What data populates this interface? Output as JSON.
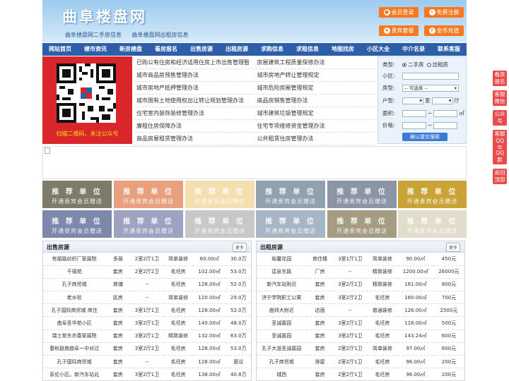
{
  "header": {
    "title": "曲阜楼盘网",
    "subtitle_links": [
      "曲阜楼盘网二手房信息",
      "曲阜楼盘网出租房信息"
    ],
    "buttons": [
      {
        "label": "会员登录",
        "icon": "user-icon"
      },
      {
        "label": "免费注册",
        "icon": "register-icon"
      },
      {
        "label": "贵宾套餐",
        "icon": "vip-icon"
      },
      {
        "label": "金币充值",
        "icon": "coin-icon"
      }
    ],
    "accent": "#f47920"
  },
  "nav": [
    "网站首页",
    "楼市资讯",
    "新房楼盘",
    "看房报名",
    "出售房源",
    "出租房源",
    "求购信息",
    "求租信息",
    "地图找房",
    "小区大全",
    "中介名录",
    "联系客服"
  ],
  "qr": {
    "caption": "扫描二维码，关注公众号"
  },
  "links": [
    [
      "已购公有住房和经济适用住房上市出售管理暂",
      "房屋建筑工程质量保修办法"
    ],
    [
      "城市商品房预售管理办法",
      "城市房地产转让管理规定"
    ],
    [
      "城市房地产抵押管理办法",
      "城市危险房屋管理规定"
    ],
    [
      "城市国有土地使用权出让转让规划管理办法",
      "商品房销售管理办法"
    ],
    [
      "住宅室内装饰装修管理办法",
      "城市建筑垃圾管理规定"
    ],
    [
      "廉租住房保障办法",
      "住宅专项维修资金管理办法"
    ],
    [
      "商品房屋租赁管理办法",
      "公共租赁住房管理办法"
    ]
  ],
  "search": {
    "type_label": "类型:",
    "opt1": "二手房",
    "opt2": "出租房",
    "area_label": "小区:",
    "kind_label": "房型:",
    "kind_value": "-- 可选择 --",
    "layout_label": "户型:",
    "room": "室",
    "hall": "厅",
    "size_label": "面积:",
    "size_unit": "㎡",
    "price_label": "价格:",
    "price_sep": "~",
    "submit": "确认提交搜索"
  },
  "ads": {
    "line1": "推 荐 单 位",
    "line2": "开通贵宾会员赠送",
    "colors": [
      "#7f7b6b",
      "#e8a07f",
      "#f3dfb0",
      "#8fa2ad",
      "#8c95a3",
      "#c9a336",
      "#7d88ad",
      "#9fa3c2",
      "#c8c8c8",
      "#a7b6c5",
      "#a59c82",
      "#e1dccb"
    ]
  },
  "sale": {
    "title": "出售房源",
    "more": "更多",
    "rows": [
      [
        "有朋路纺织厂家属院",
        "多层",
        "2室2厅1卫",
        "简单装修",
        "60.00㎡",
        "30.0万"
      ],
      [
        "千禧苑",
        "套房",
        "2室2厅2卫",
        "毛坯房",
        "102.00㎡",
        "53.0万"
      ],
      [
        "孔子商贸城",
        "商铺",
        "--",
        "毛坯房",
        "128.00㎡",
        "52.0万"
      ],
      [
        "老水校",
        "民房",
        "--",
        "简单装修",
        "120.00㎡",
        "29.0万"
      ],
      [
        "孔子国际商贸城 商住",
        "套房",
        "3室1厅1卫",
        "毛坯房",
        "128.00㎡",
        "52.0万"
      ],
      [
        "曲阜圣华苑小区",
        "套房",
        "3室2厅1卫",
        "毛坯房",
        "140.00㎡",
        "48.0万"
      ],
      [
        "瑞士苑东农委家属院",
        "套房",
        "3室2厅1卫",
        "精致装修",
        "132.00㎡",
        "63.0万"
      ],
      [
        "春秋路南曲阜一中对过",
        "套房",
        "3室2厅2卫",
        "毛坯房",
        "128.00㎡",
        "53.0万"
      ],
      [
        "孔子国际商贸城",
        "套房",
        "--",
        "毛坯房",
        "128.00㎡",
        "面议"
      ],
      [
        "系伦小区。新汽车站北",
        "套房",
        "3室2厅1卫",
        "毛坯房",
        "138.00㎡",
        "40.8万"
      ]
    ]
  },
  "rent": {
    "title": "出租房源",
    "more": "更多",
    "rows": [
      [
        "裕馨花园",
        "商住楼",
        "3室1厅1卫",
        "简单装修",
        "90.00㎡",
        "450元"
      ],
      [
        "逵泉东路",
        "厂房",
        "--",
        "精致装修",
        "1200.00㎡",
        "26000元"
      ],
      [
        "新汽车站附近",
        "套房",
        "3室2厅2卫",
        "精致装修",
        "161.00㎡",
        "800元"
      ],
      [
        "济宁学院职工公寓",
        "套房",
        "3室2厅2卫",
        "毛坯房",
        "160.00㎡",
        "700元"
      ],
      [
        "曲师大附近",
        "店面",
        "--",
        "普通装修",
        "126.00㎡",
        "2500元"
      ],
      [
        "圣诚嘉园",
        "套房",
        "3室2厅1卫",
        "毛坯房",
        "118.00㎡",
        "500元"
      ],
      [
        "圣诚嘉园",
        "套房",
        "3室2厅1卫",
        "毛坯房",
        "143.24㎡",
        "600元"
      ],
      [
        "孔子大道圣诚嘉园",
        "套房",
        "2室2厅1卫",
        "简单装修",
        "97.00㎡",
        "600元"
      ],
      [
        "孔子商贸城",
        "排屋",
        "2室2厅1卫",
        "毛坯房",
        "96.00㎡",
        "200元"
      ],
      [
        "城西",
        "套房",
        "2室2厅1卫",
        "毛坯房",
        "96.00㎡",
        "200元"
      ]
    ]
  },
  "right_tabs": [
    "看房报名",
    "客服微信",
    "公众号",
    "客服QQ号",
    "QQ群",
    "返回顶部"
  ]
}
